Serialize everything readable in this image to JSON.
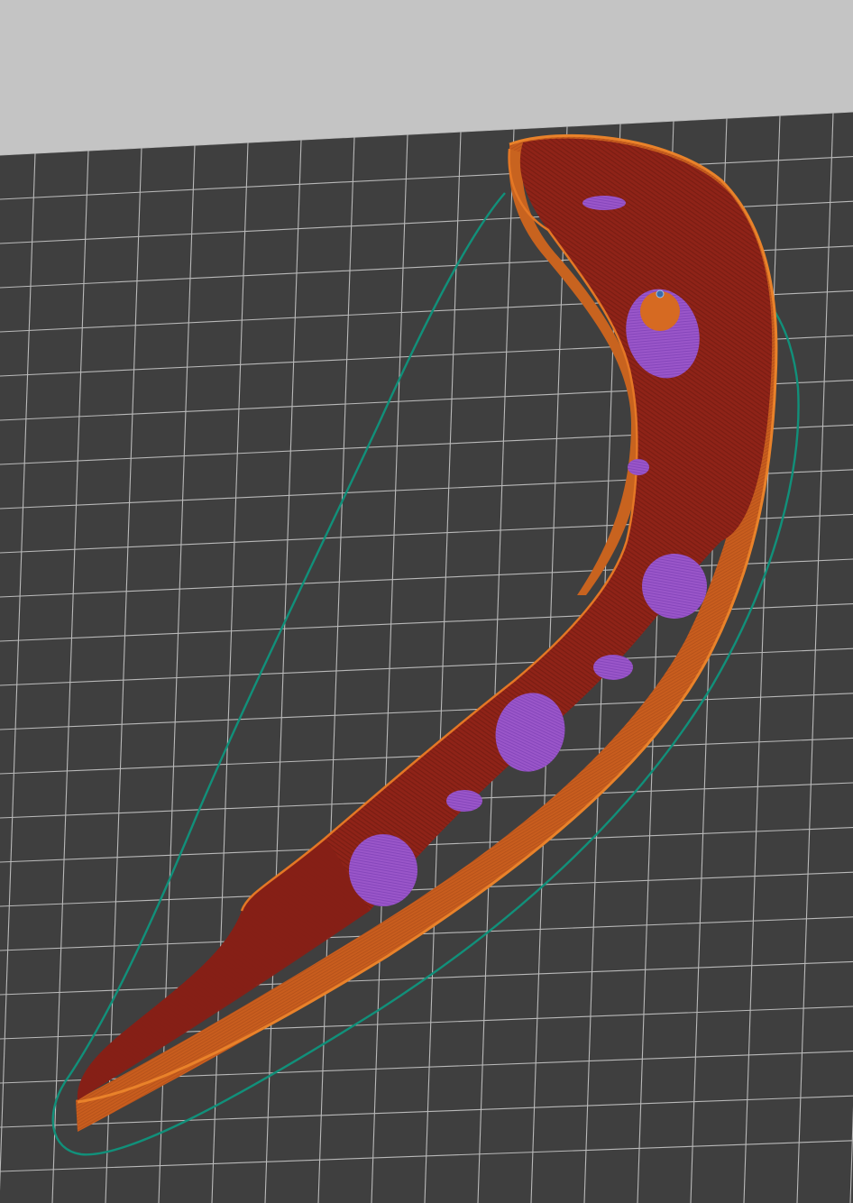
{
  "viewport": {
    "background_color": "#c4c4c4",
    "bed_color": "#3f3f3f",
    "grid_color": "#d8d8d8",
    "skirt_color": "#11907a"
  },
  "model": {
    "wall_color": "#c85d1e",
    "wall_dark_color": "#9c4012",
    "rim_color": "#e0731f",
    "infill_color": "#8f2318",
    "infill_dark_color": "#6e1a10",
    "support_color": "#9a56c9",
    "support_dark_color": "#7b3fb0",
    "nozzle_marker_icon": "nozzle-marker-icon"
  }
}
